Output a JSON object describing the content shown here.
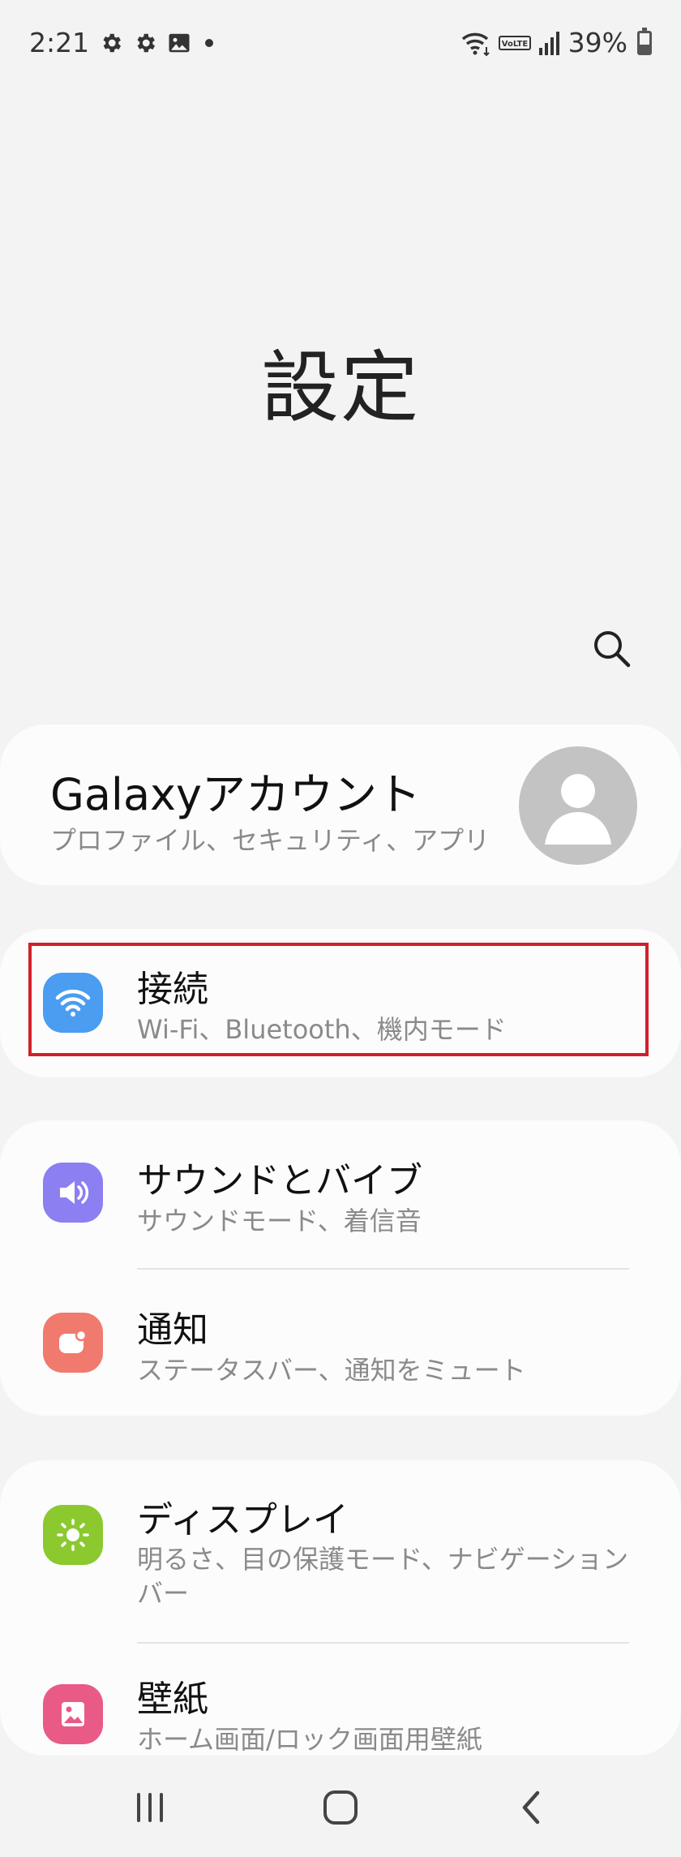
{
  "status_bar": {
    "time": "2:21",
    "left_icons": [
      "gear-icon",
      "gear-icon",
      "image-icon",
      "dot-icon"
    ],
    "right_icons": [
      "wifi-icon",
      "volte-icon",
      "signal-icon",
      "battery-icon"
    ],
    "volte_label": "VoLTE",
    "battery_percent": "39%",
    "battery_level": 0.39
  },
  "header": {
    "title": "設定",
    "search_icon": "search-icon"
  },
  "account": {
    "name": "Galaxyアカウント",
    "subtitle": "プロファイル、セキュリティ、アプリ",
    "avatar_icon": "person-icon"
  },
  "settings": [
    {
      "id": "connections",
      "title": "接続",
      "subtitle": "Wi-Fi、Bluetooth、機内モード",
      "icon": "wifi-icon",
      "color": "#4a9df0",
      "highlighted": true
    },
    {
      "id": "sound",
      "title": "サウンドとバイブ",
      "subtitle": "サウンドモード、着信音",
      "icon": "speaker-icon",
      "color": "#8c7ff2"
    },
    {
      "id": "notifications",
      "title": "通知",
      "subtitle": "ステータスバー、通知をミュート",
      "icon": "notification-icon",
      "color": "#f17a6e"
    },
    {
      "id": "display",
      "title": "ディスプレイ",
      "subtitle": "明るさ、目の保護モード、ナビゲーションバー",
      "icon": "brightness-icon",
      "color": "#8bc92f"
    },
    {
      "id": "wallpaper",
      "title": "壁紙",
      "subtitle": "ホーム画面/ロック画面用壁紙",
      "icon": "wallpaper-icon",
      "color": "#ea5a87"
    }
  ],
  "nav_bar": {
    "buttons": [
      "recents-icon",
      "home-icon",
      "back-icon"
    ]
  },
  "colors": {
    "background": "#f3f3f3",
    "card": "#fcfcfc",
    "highlight_border": "#d0202a",
    "subtitle_text": "#8a8a8a"
  }
}
